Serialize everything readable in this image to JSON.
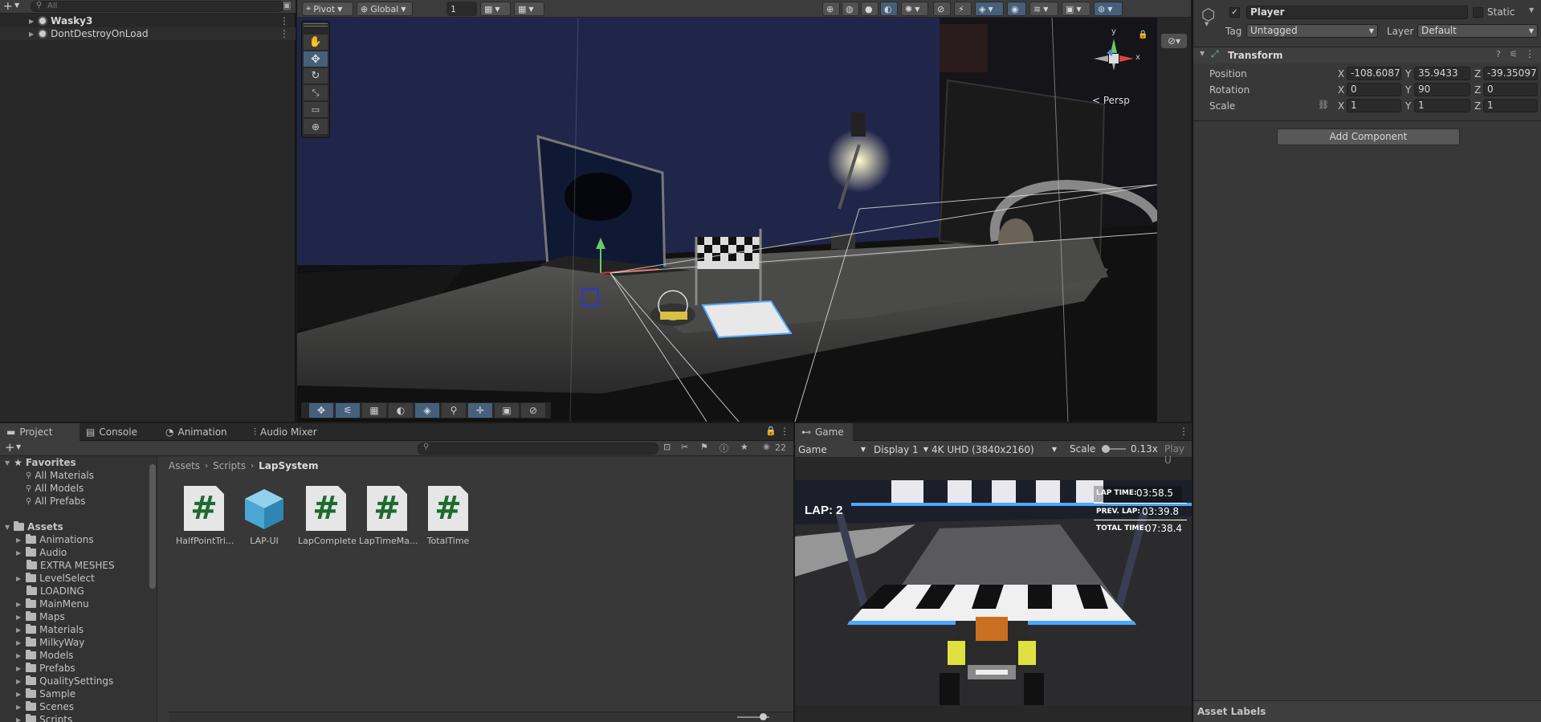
{
  "hierarchy": {
    "search_placeholder": "All",
    "items": [
      {
        "label": "Wasky3"
      },
      {
        "label": "DontDestroyOnLoad"
      }
    ]
  },
  "scene_toolbar": {
    "pivot_label": "Pivot",
    "global_label": "Global",
    "snap_value": "1"
  },
  "scene_view": {
    "persp_label": "< Persp",
    "gizmo_axes": {
      "y": "y",
      "x": "x"
    }
  },
  "inspector": {
    "object_name": "Player",
    "static_label": "Static",
    "tag_label": "Tag",
    "tag_value": "Untagged",
    "layer_label": "Layer",
    "layer_value": "Default",
    "component_title": "Transform",
    "position_label": "Position",
    "rotation_label": "Rotation",
    "scale_label": "Scale",
    "position": {
      "x": "-108.6087",
      "y": "35.9433",
      "z": "-39.35097"
    },
    "rotation": {
      "x": "0",
      "y": "90",
      "z": "0"
    },
    "scale": {
      "x": "1",
      "y": "1",
      "z": "1"
    },
    "axis_x": "X",
    "axis_y": "Y",
    "axis_z": "Z",
    "add_component_label": "Add Component",
    "asset_labels": "Asset Labels"
  },
  "project_tabs": [
    {
      "label": "Project"
    },
    {
      "label": "Console"
    },
    {
      "label": "Animation"
    },
    {
      "label": "Audio Mixer"
    }
  ],
  "project": {
    "visible_count": "22",
    "favorites_label": "Favorites",
    "favorites": [
      "All Materials",
      "All Models",
      "All Prefabs"
    ],
    "assets_label": "Assets",
    "folders": [
      "Animations",
      "Audio",
      "EXTRA MESHES",
      "LevelSelect",
      "LOADING",
      "MainMenu",
      "Maps",
      "Materials",
      "MilkyWay",
      "Models",
      "Prefabs",
      "QualitySettings",
      "Sample",
      "Scenes",
      "Scripts"
    ],
    "breadcrumb": [
      "Assets",
      "Scripts",
      "LapSystem"
    ],
    "files": [
      {
        "label": "HalfPointTri...",
        "icon": "script-icon"
      },
      {
        "label": "LAP-UI",
        "icon": "prefab-icon"
      },
      {
        "label": "LapComplete",
        "icon": "script-icon"
      },
      {
        "label": "LapTimeMa...",
        "icon": "script-icon"
      },
      {
        "label": "TotalTime",
        "icon": "script-icon"
      }
    ]
  },
  "game": {
    "tab_label": "Game",
    "mode": "Game",
    "display": "Display 1",
    "resolution": "4K UHD (3840x2160)",
    "scale_label": "Scale",
    "scale_value": "0.13x",
    "play_label": "Play U",
    "hud": {
      "lap": "LAP: 2",
      "lap_time_label": "LAP TIME:",
      "lap_time": "03:58.5",
      "prev_lap_label": "PREV. LAP:",
      "prev_lap": "03:39.8",
      "total_time_label": "TOTAL TIME:",
      "total_time": "07:38.4"
    }
  },
  "colors": {
    "accent": "#46607c",
    "script_green": "#1d6b2f",
    "prefab_blue": "#5bb8e0"
  }
}
